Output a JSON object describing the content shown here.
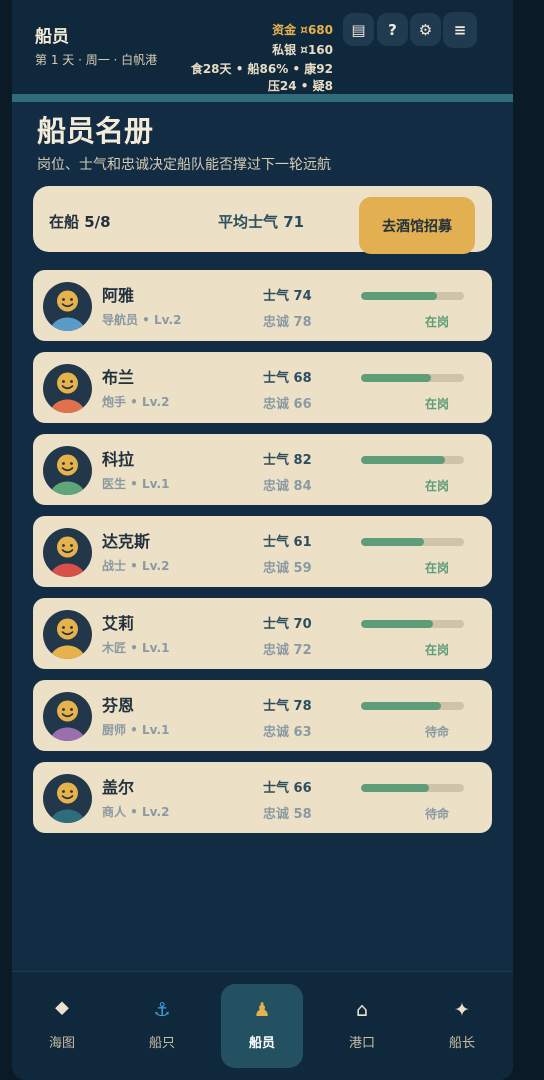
{
  "header": {
    "title": "船员",
    "subtitle": "第 1 天 · 周一 · 白帆港",
    "funds": "资金 ¤680",
    "silver": "私银 ¤160",
    "status_line1": "食28天 • 船86% • 康92",
    "status_line2": "压24 • 疑8",
    "buttons": {
      "log": "▤",
      "help": "?",
      "settings": "⚙",
      "menu": "≡"
    }
  },
  "page": {
    "title": "船员名册",
    "subtitle": "岗位、士气和忠诚决定船队能否撑过下一轮远航"
  },
  "summary": {
    "onboard": "在船 5/8",
    "avg_morale": "平均士气 71",
    "recruit_button": "去酒馆招募"
  },
  "crew": [
    {
      "name": "阿雅",
      "role": "导航员 • Lv.2",
      "morale": "士气 74",
      "loyalty": "忠诚 78",
      "morale_value": 74,
      "status": "在岗",
      "avatar_color": "#5b9bc8"
    },
    {
      "name": "布兰",
      "role": "炮手 • Lv.2",
      "morale": "士气 68",
      "loyalty": "忠诚 66",
      "morale_value": 68,
      "status": "在岗",
      "avatar_color": "#e0714f"
    },
    {
      "name": "科拉",
      "role": "医生 • Lv.1",
      "morale": "士气 82",
      "loyalty": "忠诚 84",
      "morale_value": 82,
      "status": "在岗",
      "avatar_color": "#5fa57a"
    },
    {
      "name": "达克斯",
      "role": "战士 • Lv.2",
      "morale": "士气 61",
      "loyalty": "忠诚 59",
      "morale_value": 61,
      "status": "在岗",
      "avatar_color": "#d9504a"
    },
    {
      "name": "艾莉",
      "role": "木匠 • Lv.1",
      "morale": "士气 70",
      "loyalty": "忠诚 72",
      "morale_value": 70,
      "status": "在岗",
      "avatar_color": "#e6b24c"
    },
    {
      "name": "芬恩",
      "role": "厨师 • Lv.1",
      "morale": "士气 78",
      "loyalty": "忠诚 63",
      "morale_value": 78,
      "status": "待命",
      "avatar_color": "#9a6fae"
    },
    {
      "name": "盖尔",
      "role": "商人 • Lv.2",
      "morale": "士气 66",
      "loyalty": "忠诚 58",
      "morale_value": 66,
      "status": "待命",
      "avatar_color": "#2f6d7b"
    }
  ],
  "nav": [
    {
      "label": "海图",
      "icon": "compass-star-icon",
      "glyph": "⯁"
    },
    {
      "label": "船只",
      "icon": "anchor-icon",
      "glyph": "⚓"
    },
    {
      "label": "船员",
      "icon": "person-icon",
      "glyph": "♟"
    },
    {
      "label": "港口",
      "icon": "house-icon",
      "glyph": "⌂"
    },
    {
      "label": "船长",
      "icon": "sparkle-icon",
      "glyph": "✦"
    }
  ],
  "active_nav": "船员",
  "colors": {
    "accent": "#e3b051",
    "card": "#ece0c7",
    "bar_fill": "#5e9d78",
    "panel": "#122c43"
  }
}
